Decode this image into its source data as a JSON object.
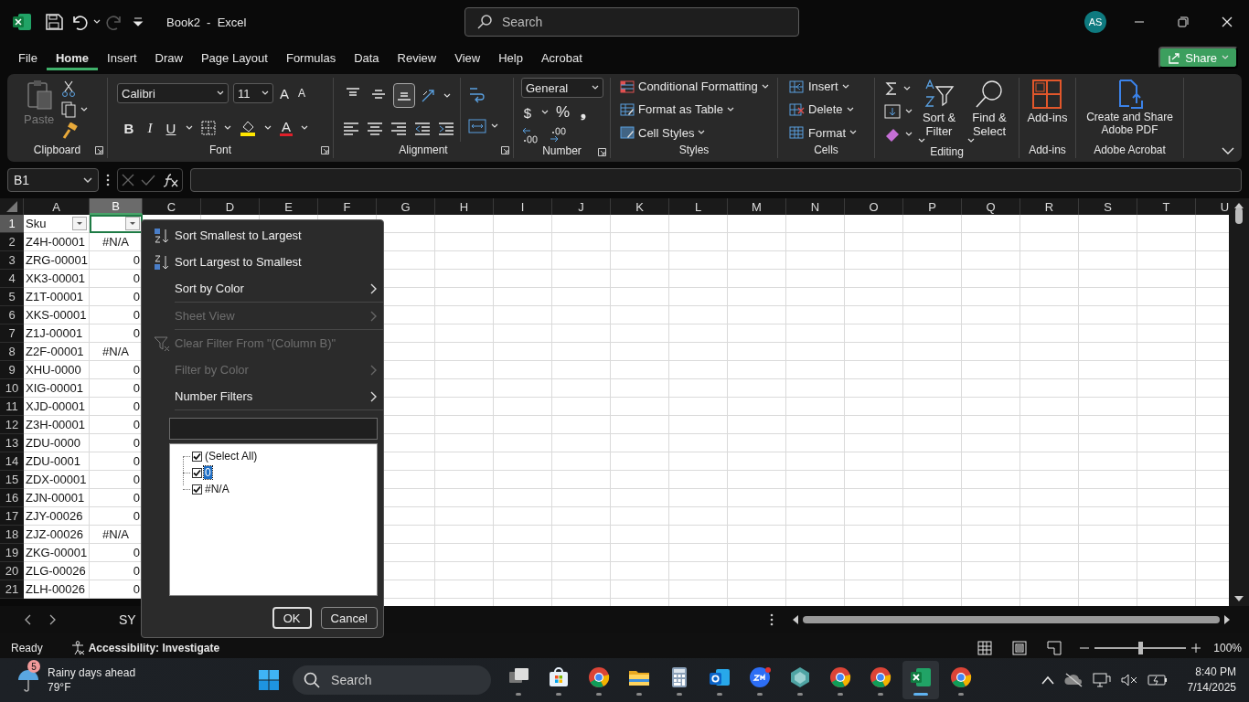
{
  "title_bar": {
    "document_title": "Book2  -  Excel",
    "search_placeholder": "Search",
    "avatar": "AS"
  },
  "menu_tabs": [
    {
      "label": "File",
      "selected": false
    },
    {
      "label": "Home",
      "selected": true
    },
    {
      "label": "Insert",
      "selected": false
    },
    {
      "label": "Draw",
      "selected": false
    },
    {
      "label": "Page Layout",
      "selected": false
    },
    {
      "label": "Formulas",
      "selected": false
    },
    {
      "label": "Data",
      "selected": false
    },
    {
      "label": "Review",
      "selected": false
    },
    {
      "label": "View",
      "selected": false
    },
    {
      "label": "Help",
      "selected": false
    },
    {
      "label": "Acrobat",
      "selected": false
    }
  ],
  "share_button": "Share",
  "ribbon": {
    "clipboard": {
      "label": "Clipboard",
      "paste": {
        "label": "Paste",
        "disabled": true
      }
    },
    "font": {
      "label": "Font",
      "font_name": "Calibri",
      "font_size": "11",
      "grow_font": "A",
      "shrink_font": "A",
      "bold": "B",
      "italic": "I",
      "underline": "U",
      "font_color": "A"
    },
    "alignment": {
      "label": "Alignment",
      "vertical_align": [
        {
          "selected": false
        },
        {
          "selected": false
        },
        {
          "selected": true
        }
      ]
    },
    "number": {
      "label": "Number",
      "format": "General",
      "currency": "$",
      "percent": "%",
      "comma": "❟"
    },
    "styles": {
      "label": "Styles",
      "commands": [
        "Conditional Formatting",
        "Format as Table",
        "Cell Styles"
      ]
    },
    "cells": {
      "label": "Cells",
      "commands": [
        "Insert",
        "Delete",
        "Format"
      ]
    },
    "editing": {
      "label": "Editing",
      "commands": [
        "Sort & Filter",
        "Find & Select"
      ]
    },
    "addins": {
      "label": "Add-ins",
      "command": "Add-ins"
    },
    "acrobat": {
      "label": "Adobe Acrobat",
      "command": "Create and Share Adobe PDF"
    }
  },
  "formula_bar": {
    "name_box": "B1"
  },
  "sheet": {
    "columns": [
      {
        "label": "A",
        "selected": false
      },
      {
        "label": "B",
        "selected": true
      },
      {
        "label": "C",
        "selected": false
      },
      {
        "label": "D",
        "selected": false
      },
      {
        "label": "E",
        "selected": false
      },
      {
        "label": "F",
        "selected": false
      },
      {
        "label": "G",
        "selected": false
      },
      {
        "label": "H",
        "selected": false
      },
      {
        "label": "I",
        "selected": false
      },
      {
        "label": "J",
        "selected": false
      },
      {
        "label": "K",
        "selected": false
      },
      {
        "label": "L",
        "selected": false
      },
      {
        "label": "M",
        "selected": false
      },
      {
        "label": "N",
        "selected": false
      },
      {
        "label": "O",
        "selected": false
      },
      {
        "label": "P",
        "selected": false
      },
      {
        "label": "Q",
        "selected": false
      },
      {
        "label": "R",
        "selected": false
      },
      {
        "label": "S",
        "selected": false
      },
      {
        "label": "T",
        "selected": false
      },
      {
        "label": "U",
        "selected": false
      }
    ],
    "rows": [
      {
        "number": "1",
        "a": "Sku",
        "selected": true
      },
      {
        "number": "2",
        "selected": false,
        "a": "Z4H-00001",
        "b": {
          "text": "#N/A",
          "kind": "error"
        }
      },
      {
        "number": "3",
        "selected": false,
        "a": "ZRG-00001",
        "b": {
          "text": "0",
          "kind": "number"
        }
      },
      {
        "number": "4",
        "selected": false,
        "a": "XK3-00001",
        "b": {
          "text": "0",
          "kind": "number"
        }
      },
      {
        "number": "5",
        "selected": false,
        "a": "Z1T-00001",
        "b": {
          "text": "0",
          "kind": "number"
        }
      },
      {
        "number": "6",
        "selected": false,
        "a": "XKS-00001",
        "b": {
          "text": "0",
          "kind": "number"
        }
      },
      {
        "number": "7",
        "selected": false,
        "a": "Z1J-00001",
        "b": {
          "text": "0",
          "kind": "number"
        }
      },
      {
        "number": "8",
        "selected": false,
        "a": "Z2F-00001",
        "b": {
          "text": "#N/A",
          "kind": "error"
        }
      },
      {
        "number": "9",
        "selected": false,
        "a": "XHU-0000",
        "b": {
          "text": "0",
          "kind": "number"
        }
      },
      {
        "number": "10",
        "selected": false,
        "a": "XIG-00001",
        "b": {
          "text": "0",
          "kind": "number"
        }
      },
      {
        "number": "11",
        "selected": false,
        "a": "XJD-00001",
        "b": {
          "text": "0",
          "kind": "number"
        }
      },
      {
        "number": "12",
        "selected": false,
        "a": "Z3H-00001",
        "b": {
          "text": "0",
          "kind": "number"
        }
      },
      {
        "number": "13",
        "selected": false,
        "a": "ZDU-0000",
        "b": {
          "text": "0",
          "kind": "number"
        }
      },
      {
        "number": "14",
        "selected": false,
        "a": "ZDU-0001",
        "b": {
          "text": "0",
          "kind": "number"
        }
      },
      {
        "number": "15",
        "selected": false,
        "a": "ZDX-00001",
        "b": {
          "text": "0",
          "kind": "number"
        }
      },
      {
        "number": "16",
        "selected": false,
        "a": "ZJN-00001",
        "b": {
          "text": "0",
          "kind": "number"
        }
      },
      {
        "number": "17",
        "selected": false,
        "a": "ZJY-00026",
        "b": {
          "text": "0",
          "kind": "number"
        }
      },
      {
        "number": "18",
        "selected": false,
        "a": "ZJZ-00026",
        "b": {
          "text": "#N/A",
          "kind": "error"
        }
      },
      {
        "number": "19",
        "selected": false,
        "a": "ZKG-00001",
        "b": {
          "text": "0",
          "kind": "number"
        }
      },
      {
        "number": "20",
        "selected": false,
        "a": "ZLG-00026",
        "b": {
          "text": "0",
          "kind": "number"
        }
      },
      {
        "number": "21",
        "selected": false,
        "a": "ZLH-00026",
        "b": {
          "text": "0",
          "kind": "number"
        }
      }
    ]
  },
  "filter_menu": {
    "sections": [
      {
        "items": [
          {
            "label": "Sort Smallest to Largest",
            "kind": "sort_ascending",
            "disabled": false,
            "submenu": false
          },
          {
            "label": "Sort Largest to Smallest",
            "kind": "sort_descending",
            "disabled": false,
            "submenu": false
          },
          {
            "label": "Sort by Color",
            "kind": "plain",
            "disabled": false,
            "submenu": true
          }
        ]
      },
      {
        "items": [
          {
            "label": "Sheet View",
            "kind": "plain",
            "disabled": true,
            "submenu": true
          }
        ]
      },
      {
        "items": [
          {
            "label": "Clear Filter From \"(Column B)\"",
            "kind": "clear_filter",
            "disabled": true,
            "submenu": false
          },
          {
            "label": "Filter by Color",
            "kind": "plain",
            "disabled": true,
            "submenu": true
          },
          {
            "label": "Number Filters",
            "kind": "plain",
            "disabled": false,
            "submenu": true
          }
        ]
      }
    ],
    "values": [
      {
        "label": "(Select All)",
        "checked": true,
        "selected": false
      },
      {
        "label": "0",
        "checked": true,
        "selected": true
      },
      {
        "label": "#N/A",
        "checked": true,
        "selected": false
      }
    ],
    "ok": "OK",
    "cancel": "Cancel"
  },
  "sheet_tabs": [
    {
      "label": "SY"
    }
  ],
  "status_bar": {
    "mode": "Ready",
    "accessibility": "Accessibility: Investigate",
    "zoom_slider": {
      "level": 0.5
    },
    "zoom": "100%"
  },
  "taskbar": {
    "weather": {
      "badge": "5",
      "title": "Rainy days ahead",
      "temperature": "79°F"
    },
    "search_placeholder": "Search",
    "apps": [
      {
        "kind": "task_view",
        "selected": false
      },
      {
        "kind": "store",
        "selected": false
      },
      {
        "kind": "chrome",
        "selected": false
      },
      {
        "kind": "folder",
        "selected": false
      },
      {
        "kind": "calculator",
        "selected": false
      },
      {
        "kind": "outlook",
        "selected": false
      },
      {
        "kind": "zoom",
        "selected": false
      },
      {
        "kind": "hexagon",
        "selected": false
      },
      {
        "kind": "chrome",
        "selected": false
      },
      {
        "kind": "chrome",
        "selected": false
      },
      {
        "kind": "excel",
        "selected": true
      },
      {
        "kind": "chrome",
        "selected": false
      }
    ],
    "time": "8:40 PM",
    "date": "7/14/2025"
  }
}
